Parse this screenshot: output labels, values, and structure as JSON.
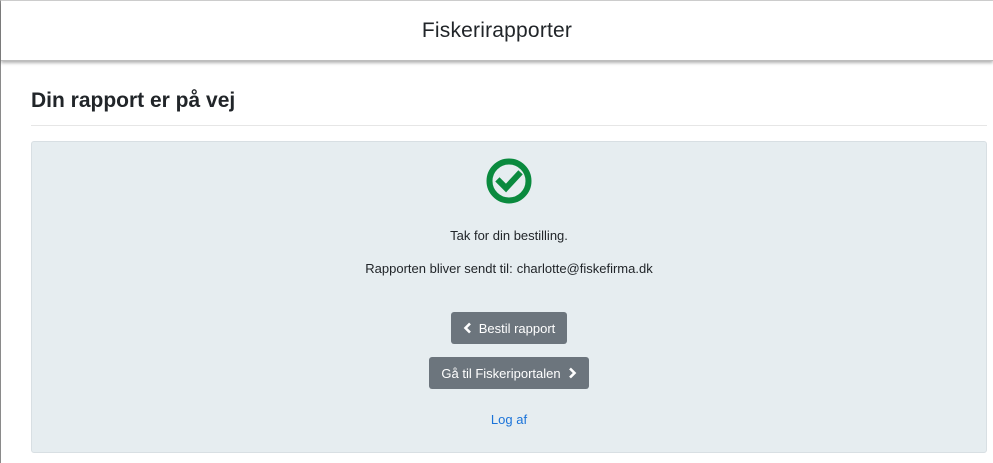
{
  "header": {
    "title": "Fiskerirapporter"
  },
  "page": {
    "title": "Din rapport er på vej"
  },
  "confirmation": {
    "icon": "check-circle-icon",
    "icon_color": "#0a8a3e",
    "thanks_text": "Tak for din bestilling.",
    "sent_to_label": "Rapporten bliver sendt til:",
    "email": "charlotte@fiskefirma.dk"
  },
  "actions": {
    "back_button": {
      "label": "Bestil rapport",
      "icon": "chevron-left-icon"
    },
    "portal_button": {
      "label": "Gå til Fiskeriportalen",
      "icon": "chevron-right-icon"
    },
    "logout_link": "Log af"
  },
  "colors": {
    "panel_bg": "#e6edf0",
    "button_bg": "#6c757d",
    "link": "#1a73d9"
  }
}
